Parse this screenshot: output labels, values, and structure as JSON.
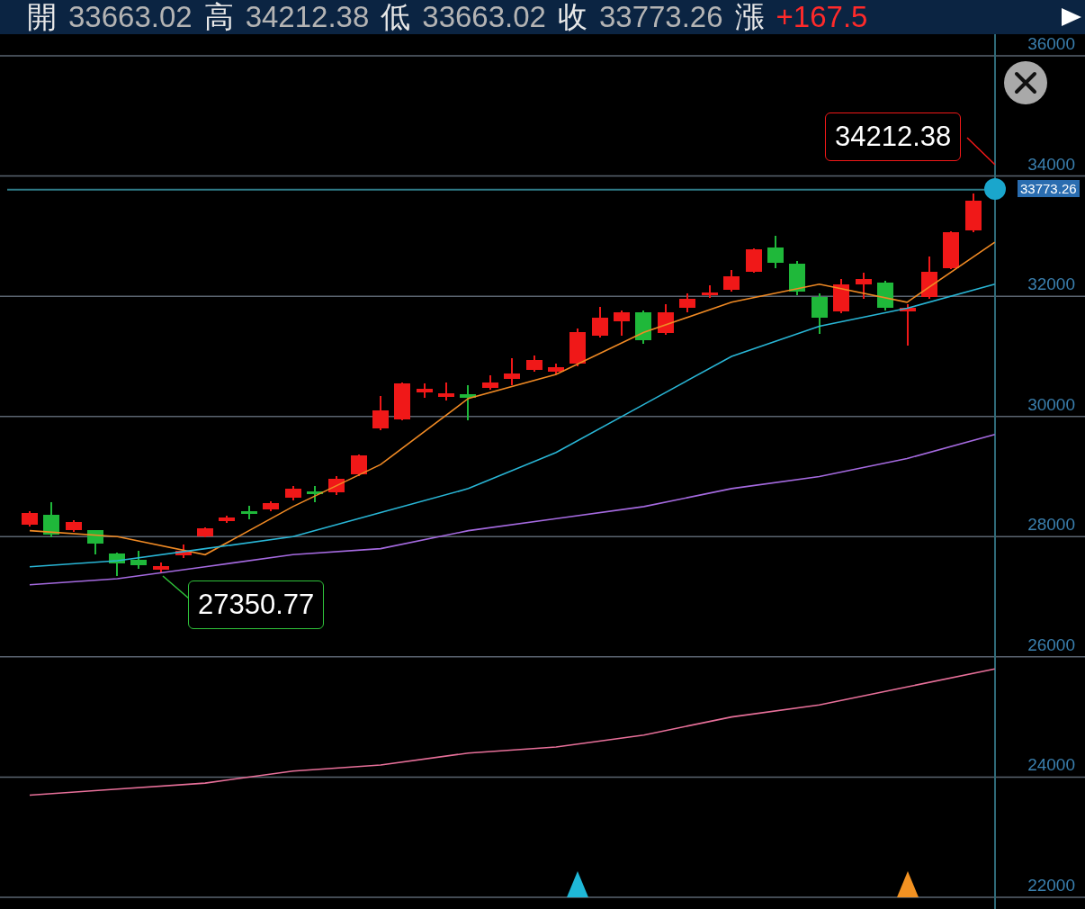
{
  "header": {
    "items": [
      {
        "label": "開",
        "value": "33663.02",
        "kind": "neutral"
      },
      {
        "label": "高",
        "value": "34212.38",
        "kind": "neutral"
      },
      {
        "label": "低",
        "value": "33663.02",
        "kind": "neutral"
      },
      {
        "label": "收",
        "value": "33773.26",
        "kind": "neutral"
      },
      {
        "label": "漲",
        "value": "+167.5",
        "kind": "rise"
      }
    ]
  },
  "chart": {
    "chart_data": {
      "type": "line",
      "grid": true,
      "ylim": [
        22000,
        36000
      ],
      "yticks": [
        36000,
        34000,
        32000,
        30000,
        28000,
        26000,
        24000,
        22000
      ],
      "ref_lines": [
        {
          "axis": "y",
          "value": 33773.26,
          "color": "#2f7a86"
        }
      ],
      "series": [
        {
          "color": "#f08a24",
          "values": [
            28100,
            28000,
            27700,
            28500,
            29200,
            30300,
            30700,
            31400,
            31900,
            32200,
            31900,
            32900
          ]
        },
        {
          "color": "#29b6d6",
          "values": [
            27500,
            27600,
            27800,
            28000,
            28400,
            28800,
            29400,
            30200,
            31000,
            31500,
            31800,
            32200
          ]
        },
        {
          "color": "#a56ae0",
          "values": [
            27200,
            27300,
            27500,
            27700,
            27800,
            28100,
            28300,
            28500,
            28800,
            29000,
            29300,
            29700
          ]
        },
        {
          "color": "#e8709a",
          "values": [
            23700,
            23800,
            23900,
            24100,
            24200,
            24400,
            24500,
            24700,
            25000,
            25200,
            25500,
            25800
          ]
        }
      ]
    },
    "current_price": "33773.26",
    "high_callout": "34212.38",
    "low_callout": "27350.77"
  }
}
